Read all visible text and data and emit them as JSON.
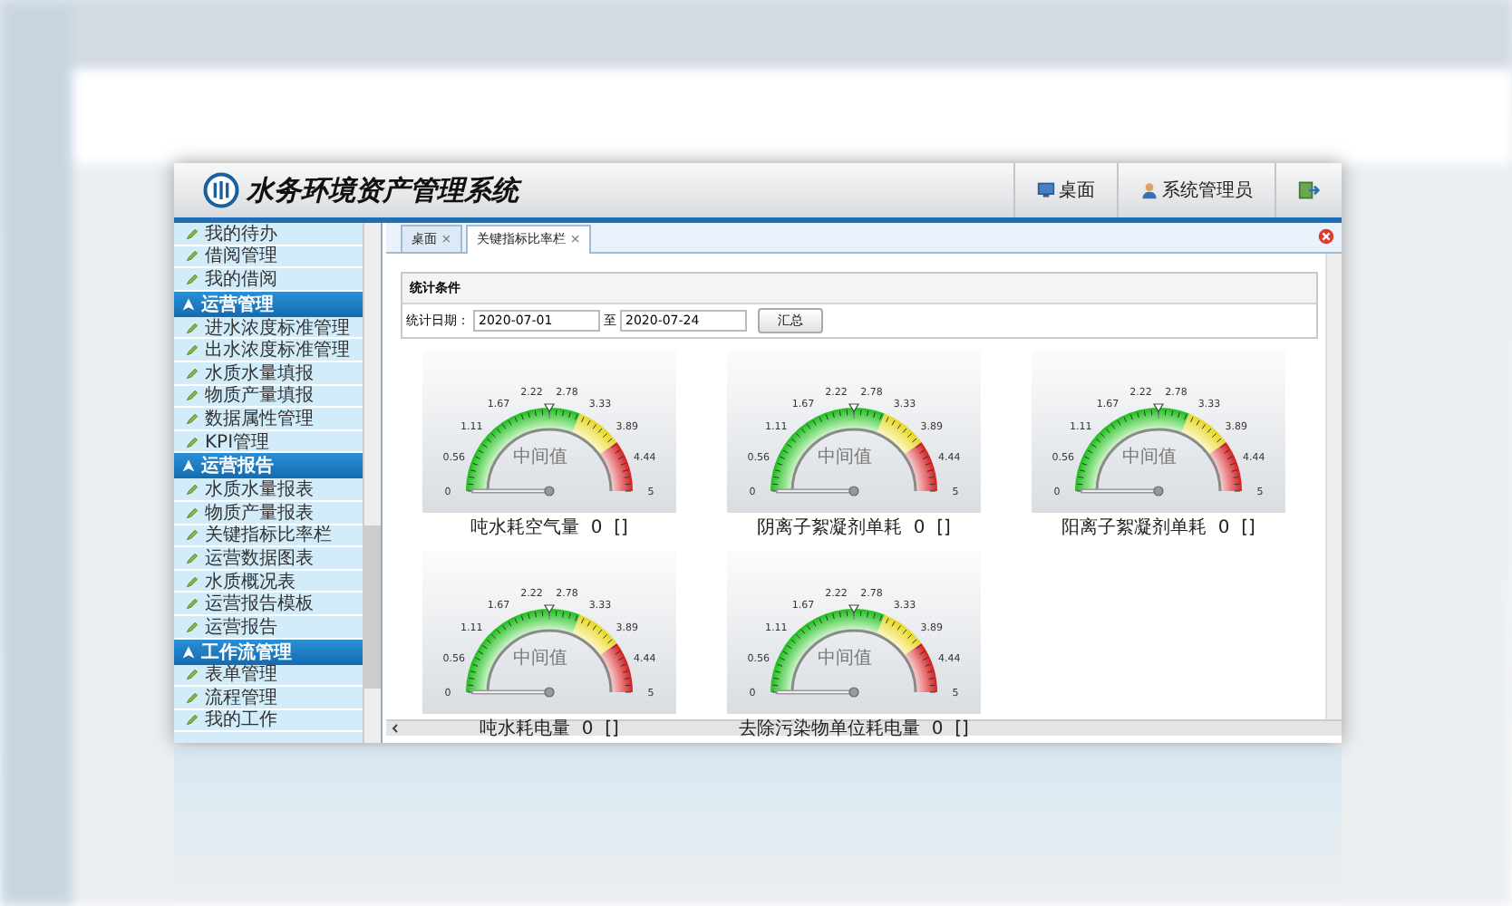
{
  "header": {
    "title": "水务环境资产管理系统",
    "buttons": [
      {
        "kind": "desktop",
        "label": "桌面"
      },
      {
        "kind": "user",
        "label": "系统管理员"
      },
      {
        "kind": "exit"
      }
    ]
  },
  "sidebar": {
    "items": [
      {
        "kind": "link",
        "label": "我的待办"
      },
      {
        "kind": "link",
        "label": "借阅管理"
      },
      {
        "kind": "link",
        "label": "我的借阅"
      },
      {
        "kind": "section",
        "label": "运营管理"
      },
      {
        "kind": "link",
        "label": "进水浓度标准管理"
      },
      {
        "kind": "link",
        "label": "出水浓度标准管理"
      },
      {
        "kind": "link",
        "label": "水质水量填报"
      },
      {
        "kind": "link",
        "label": "物质产量填报"
      },
      {
        "kind": "link",
        "label": "数据属性管理"
      },
      {
        "kind": "link",
        "label": "KPI管理"
      },
      {
        "kind": "section",
        "label": "运营报告"
      },
      {
        "kind": "link",
        "label": "水质水量报表"
      },
      {
        "kind": "link",
        "label": "物质产量报表"
      },
      {
        "kind": "link",
        "label": "关键指标比率栏"
      },
      {
        "kind": "link",
        "label": "运营数据图表"
      },
      {
        "kind": "link",
        "label": "水质概况表"
      },
      {
        "kind": "link",
        "label": "运营报告模板"
      },
      {
        "kind": "link",
        "label": "运营报告"
      },
      {
        "kind": "section",
        "label": "工作流管理"
      },
      {
        "kind": "link",
        "label": "表单管理"
      },
      {
        "kind": "link",
        "label": "流程管理"
      },
      {
        "kind": "link",
        "label": "我的工作"
      }
    ]
  },
  "tabs": [
    {
      "label": "桌面",
      "close": "×",
      "selected": false
    },
    {
      "label": "关键指标比率栏",
      "close": "×",
      "selected": true
    }
  ],
  "filter": {
    "title": "统计条件",
    "date_label": "统计日期：",
    "from": "2020-07-01",
    "to_label": "至",
    "to": "2020-07-24",
    "button": "汇总"
  },
  "gauges": [
    {
      "name": "吨水耗空气量",
      "value": "0",
      "unit": "[]",
      "center_label": "中间值",
      "ticks": [
        "0",
        "0.56",
        "1.11",
        "1.67",
        "2.22",
        "2.78",
        "3.33",
        "3.89",
        "4.44",
        "5"
      ]
    },
    {
      "name": "阴离子絮凝剂单耗",
      "value": "0",
      "unit": "[]",
      "center_label": "中间值",
      "ticks": [
        "0",
        "0.56",
        "1.11",
        "1.67",
        "2.22",
        "2.78",
        "3.33",
        "3.89",
        "4.44",
        "5"
      ]
    },
    {
      "name": "阳离子絮凝剂单耗",
      "value": "0",
      "unit": "[]",
      "center_label": "中间值",
      "ticks": [
        "0",
        "0.56",
        "1.11",
        "1.67",
        "2.22",
        "2.78",
        "3.33",
        "3.89",
        "4.44",
        "5"
      ]
    },
    {
      "name": "吨水耗电量",
      "value": "0",
      "unit": "[]",
      "center_label": "中间值",
      "ticks": [
        "0",
        "0.56",
        "1.11",
        "1.67",
        "2.22",
        "2.78",
        "3.33",
        "3.89",
        "4.44",
        "5"
      ]
    },
    {
      "name": "去除污染物单位耗电量",
      "value": "0",
      "unit": "[]",
      "center_label": "中间值",
      "ticks": [
        "0",
        "0.56",
        "1.11",
        "1.67",
        "2.22",
        "2.78",
        "3.33",
        "3.89",
        "4.44",
        "5"
      ]
    }
  ]
}
